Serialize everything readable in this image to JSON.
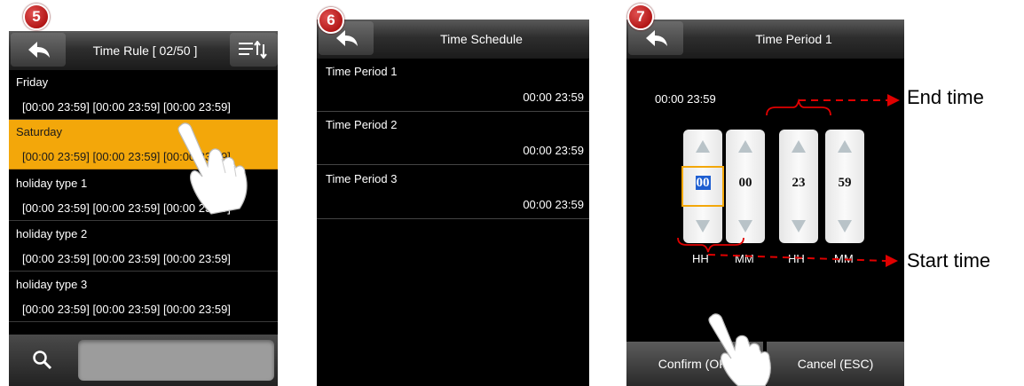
{
  "screen5": {
    "step": "5",
    "title": "Time Rule [ 02/50 ]",
    "rows": [
      {
        "name": "Friday",
        "value": "[00:00 23:59] [00:00 23:59] [00:00 23:59]",
        "selected": false
      },
      {
        "name": "Saturday",
        "value": "[00:00 23:59] [00:00 23:59] [00:00 23:59]",
        "selected": true
      },
      {
        "name": "holiday type 1",
        "value": "[00:00 23:59] [00:00 23:59] [00:00 23:59]",
        "selected": false
      },
      {
        "name": "holiday type 2",
        "value": "[00:00 23:59] [00:00 23:59] [00:00 23:59]",
        "selected": false
      },
      {
        "name": "holiday type 3",
        "value": "[00:00 23:59] [00:00 23:59] [00:00 23:59]",
        "selected": false
      }
    ],
    "icons": {
      "back": "back-arrow-icon",
      "sort": "sort-icon",
      "search": "search-icon",
      "hand": "pointing-hand-icon"
    }
  },
  "screen6": {
    "step": "6",
    "title": "Time Schedule",
    "periods": [
      {
        "name": "Time Period 1",
        "value": "00:00  23:59"
      },
      {
        "name": "Time Period 2",
        "value": "00:00  23:59"
      },
      {
        "name": "Time Period 3",
        "value": "00:00  23:59"
      }
    ],
    "icons": {
      "back": "back-arrow-icon"
    }
  },
  "screen7": {
    "step": "7",
    "title": "Time Period 1",
    "current_value": "00:00  23:59",
    "spinners": [
      {
        "value": "00",
        "highlighted": true
      },
      {
        "value": "00",
        "highlighted": false
      },
      {
        "value": "23",
        "highlighted": false
      },
      {
        "value": "59",
        "highlighted": false
      }
    ],
    "labels": [
      "HH",
      "MM",
      "HH",
      "MM"
    ],
    "confirm_label": "Confirm (OK)",
    "cancel_label": "Cancel (ESC)",
    "icons": {
      "back": "back-arrow-icon",
      "up": "up-arrow-icon",
      "down": "down-arrow-icon",
      "hand": "pointing-hand-icon"
    }
  },
  "annotations": {
    "end_time": "End time",
    "start_time": "Start time"
  },
  "colors": {
    "selection": "#f3a70a",
    "highlight": "#1f5fd1",
    "annotation": "#e00000",
    "step_badge": "#c00000"
  }
}
